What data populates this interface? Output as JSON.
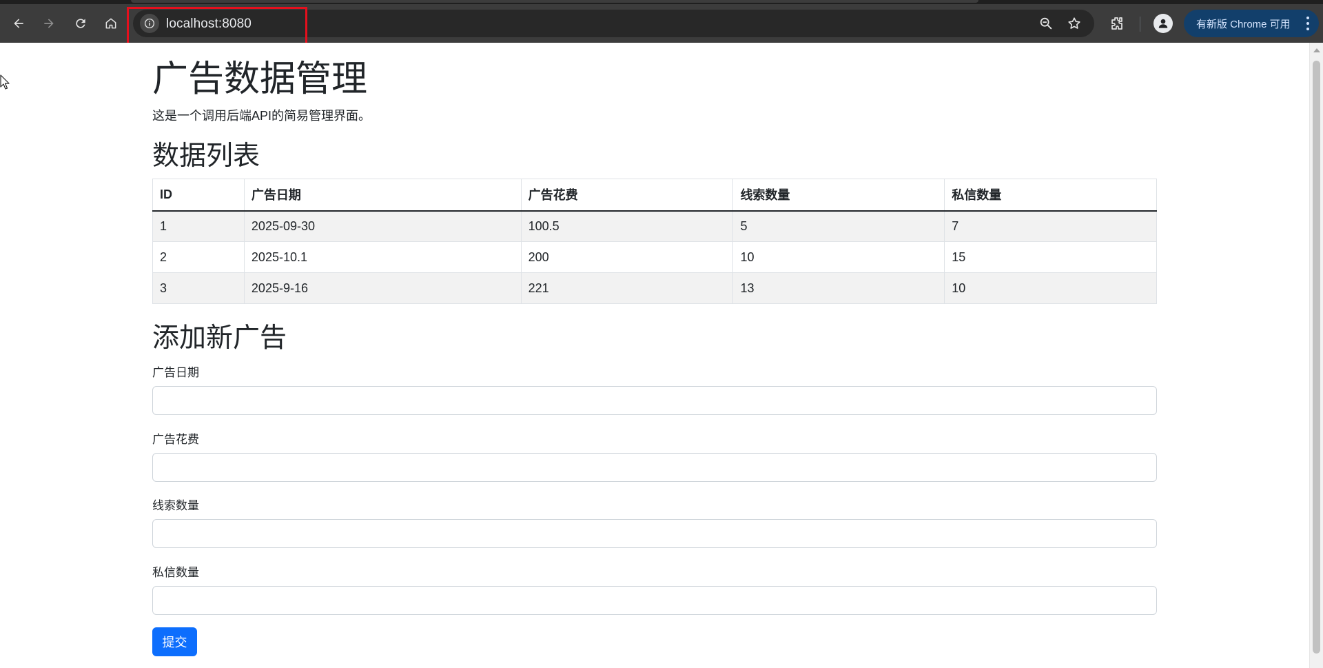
{
  "browser": {
    "url": "localhost:8080",
    "update_label": "有新版 Chrome 可用"
  },
  "page": {
    "title": "广告数据管理",
    "lead": "这是一个调用后端API的简易管理界面。",
    "list_heading": "数据列表",
    "table": {
      "headers": [
        "ID",
        "广告日期",
        "广告花费",
        "线索数量",
        "私信数量"
      ],
      "rows": [
        [
          "1",
          "2025-09-30",
          "100.5",
          "5",
          "7"
        ],
        [
          "2",
          "2025-10.1",
          "200",
          "10",
          "15"
        ],
        [
          "3",
          "2025-9-16",
          "221",
          "13",
          "10"
        ]
      ]
    },
    "form": {
      "heading": "添加新广告",
      "fields": [
        {
          "label": "广告日期",
          "value": ""
        },
        {
          "label": "广告花费",
          "value": ""
        },
        {
          "label": "线索数量",
          "value": ""
        },
        {
          "label": "私信数量",
          "value": ""
        }
      ],
      "submit_label": "提交"
    }
  },
  "colors": {
    "primary": "#0d6efd",
    "highlight": "#e5101d",
    "toolbar": "#3c3c3c"
  },
  "icons": [
    "back-arrow-icon",
    "forward-arrow-icon",
    "reload-icon",
    "home-icon",
    "info-icon",
    "zoom-out-icon",
    "star-icon",
    "extensions-icon",
    "profile-icon",
    "more-vert-icon"
  ]
}
